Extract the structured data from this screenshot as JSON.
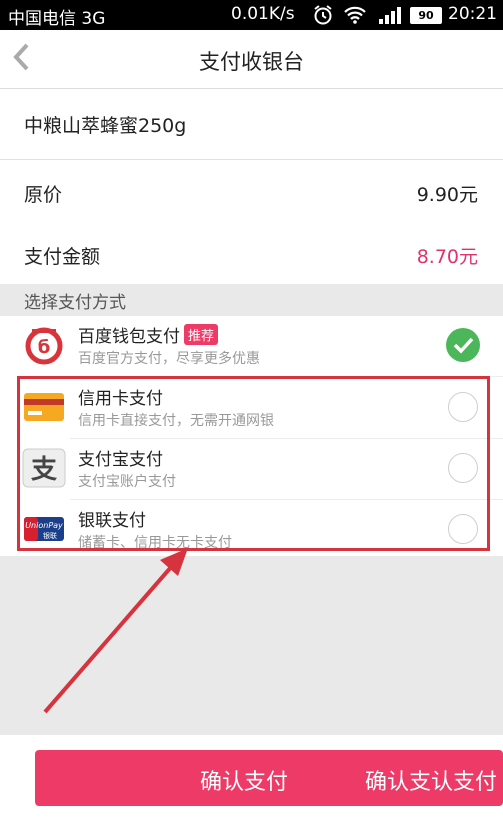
{
  "status_bar": {
    "carrier": "中国电信 3G",
    "speed": "0.01K/s",
    "battery": "90",
    "time": "20:21"
  },
  "header": {
    "back_icon": "chevron-left-icon",
    "title": "支付收银台"
  },
  "order": {
    "product_name": "中粮山萃蜂蜜250g",
    "original_price_label": "原价",
    "original_price": "9.90元",
    "pay_amount_label": "支付金额",
    "pay_amount": "8.70元",
    "pay_amount_color": "#e0336b"
  },
  "payment": {
    "section_label": "选择支付方式",
    "methods": [
      {
        "name": "百度钱包支付",
        "badge": "推荐",
        "desc": "百度官方支付，尽享更多优惠",
        "icon": "baidu-wallet-icon",
        "selected": true
      },
      {
        "name": "信用卡支付",
        "desc": "信用卡直接支付，无需开通网银",
        "icon": "credit-card-icon",
        "selected": false
      },
      {
        "name": "支付宝支付",
        "desc": "支付宝账户支付",
        "icon": "alipay-icon",
        "selected": false
      },
      {
        "name": "银联支付",
        "desc": "储蓄卡、信用卡无卡支付",
        "icon": "unionpay-icon",
        "selected": false
      }
    ],
    "unionpay_logo_text": "UnionPay",
    "unionpay_logo_cn": "银联"
  },
  "footer": {
    "confirm_label": "确认支付",
    "confirm_ghost": "确认支认支付"
  },
  "colors": {
    "accent": "#ee3a67",
    "selected": "#4cb65b",
    "annotation": "#d5333d"
  }
}
